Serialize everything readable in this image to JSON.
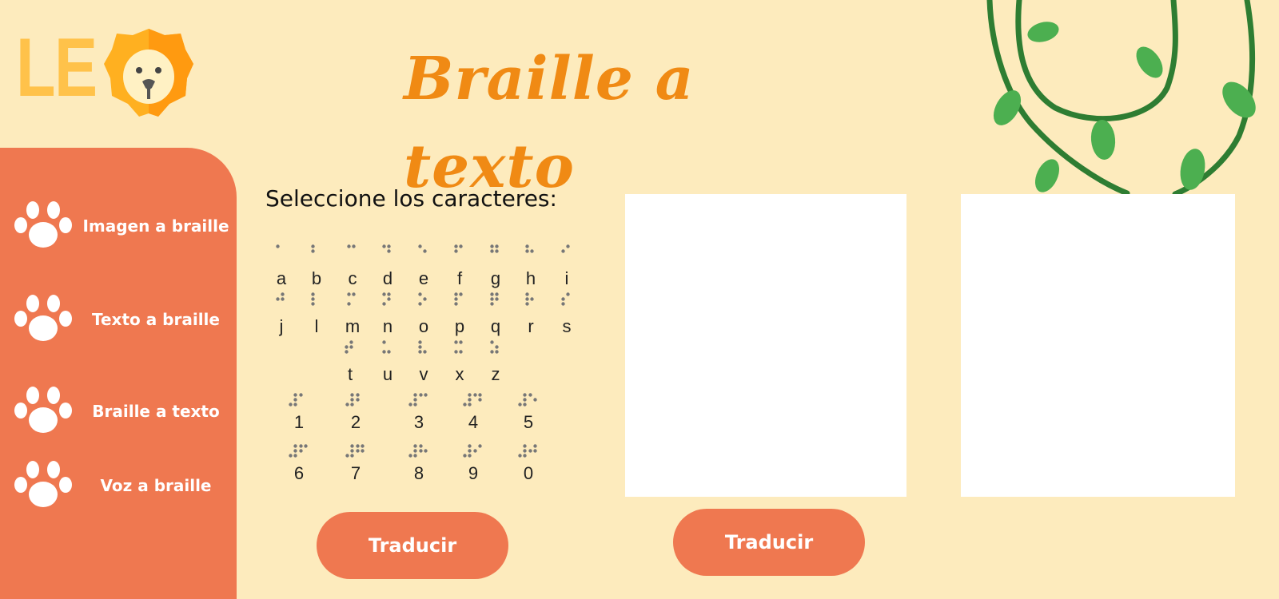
{
  "logo": {
    "text": "LE",
    "icon": "lion-icon"
  },
  "title": "Braille a texto",
  "sidebar": {
    "items": [
      {
        "label": "Imagen a braille",
        "icon": "paw-icon"
      },
      {
        "label": "Texto a braille",
        "icon": "paw-icon"
      },
      {
        "label": "Braille a texto",
        "icon": "paw-icon"
      },
      {
        "label": "Voz a braille",
        "icon": "paw-icon"
      }
    ]
  },
  "main": {
    "select_label": "Seleccione los caracteres:",
    "letters_row1": [
      "a",
      "b",
      "c",
      "d",
      "e",
      "f",
      "g",
      "h",
      "i"
    ],
    "letters_row2": [
      "j",
      "l",
      "m",
      "n",
      "o",
      "p",
      "q",
      "r",
      "s"
    ],
    "letters_row3": [
      "t",
      "u",
      "v",
      "x",
      "z"
    ],
    "numbers_row1": [
      "1",
      "2",
      "3",
      "4",
      "5"
    ],
    "numbers_row2": [
      "6",
      "7",
      "8",
      "9",
      "0"
    ],
    "translate_left_label": "Traducir",
    "translate_right_label": "Traducir",
    "input_text": "",
    "output_text": ""
  },
  "colors": {
    "background": "#fdebbd",
    "sidebar": "#ef7850",
    "title": "#f08a14",
    "logo": "#ffc24a",
    "vine": "#2e7d32",
    "leaf": "#4caf50"
  }
}
